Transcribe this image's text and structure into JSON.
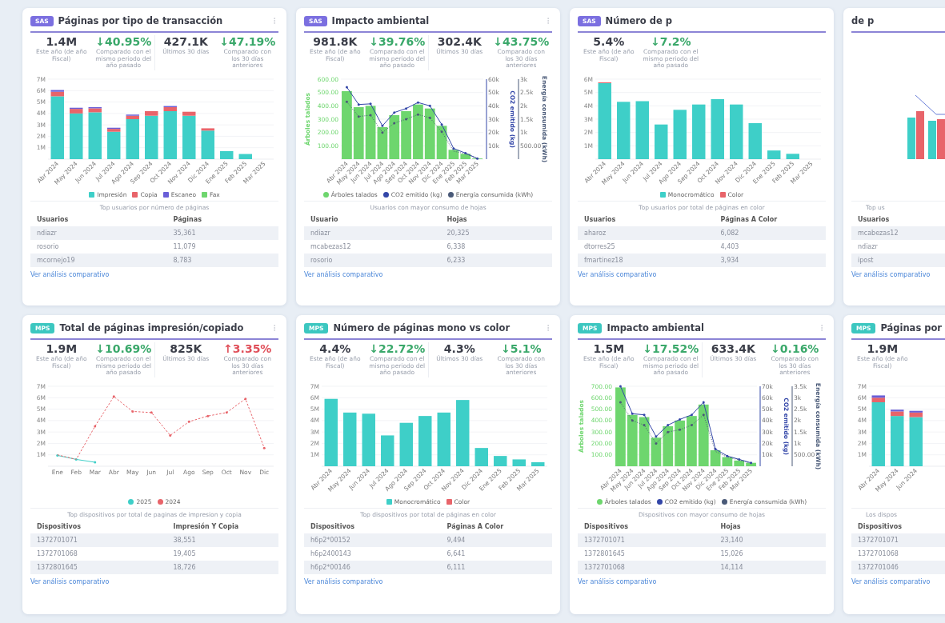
{
  "cards": [
    {
      "badge": {
        "text": "SAS",
        "color": "#7b6fe0"
      },
      "title": "Páginas por tipo de transacción",
      "menu_icon": true,
      "stats": [
        {
          "value": "1.4M",
          "label": "Este año (de año Fiscal)",
          "color": "#3a3d48"
        },
        {
          "value": "↓40.95%",
          "label": "Comparado con el mismo periodo del año pasado",
          "color": "#3aa86a"
        },
        {
          "value": "427.1K",
          "label": "Últimos 30 días",
          "color": "#3a3d48"
        },
        {
          "value": "↓47.19%",
          "label": "Comparado con los 30 días anteriores",
          "color": "#3aa86a"
        }
      ],
      "chart_data": {
        "type": "bar",
        "stacked": true,
        "grid": true,
        "categories": [
          "Abr 2024",
          "May 2024",
          "Jun 2024",
          "Jul 2024",
          "Ago 2024",
          "Sep 2024",
          "Oct 2024",
          "Nov 2024",
          "Dic 2024",
          "Ene 2025",
          "Feb 2025",
          "Mar 2025"
        ],
        "ylim": [
          0,
          7
        ],
        "yticks": [
          {
            "value": 1,
            "label": "1M"
          },
          {
            "value": 2,
            "label": "2M"
          },
          {
            "value": 3,
            "label": "3M"
          },
          {
            "value": 4,
            "label": "4M"
          },
          {
            "value": 5,
            "label": "5M"
          },
          {
            "value": 6,
            "label": "6M"
          },
          {
            "value": 7,
            "label": "7M"
          }
        ],
        "series": [
          {
            "name": "Impresión",
            "color": "#3ecfc8",
            "values": [
              5.5,
              4.0,
              4.1,
              2.4,
              3.5,
              3.8,
              4.2,
              3.8,
              2.5,
              0.7,
              0.45,
              0
            ]
          },
          {
            "name": "Copia",
            "color": "#e8646a",
            "values": [
              0.4,
              0.4,
              0.35,
              0.25,
              0.3,
              0.4,
              0.35,
              0.35,
              0.2,
              0.05,
              0.03,
              0
            ]
          },
          {
            "name": "Escaneo",
            "color": "#6a5fd8",
            "values": [
              0.15,
              0.1,
              0.1,
              0.1,
              0.1,
              0.05,
              0.1,
              0.05,
              0.05,
              0.02,
              0.01,
              0
            ]
          },
          {
            "name": "Fax",
            "color": "#6ed66e",
            "values": [
              0,
              0,
              0,
              0,
              0,
              0,
              0,
              0,
              0,
              0,
              0,
              0
            ]
          }
        ]
      },
      "table_title": "Top usuarios por número de páginas",
      "columns": [
        "Usuarios",
        "Páginas"
      ],
      "rows": [
        [
          "ndiazr",
          "35,361"
        ],
        [
          "rosorio",
          "11,079"
        ],
        [
          "mcornejo19",
          "8,783"
        ]
      ],
      "link": "Ver análisis comparativo"
    },
    {
      "badge": {
        "text": "SAS",
        "color": "#7b6fe0"
      },
      "title": "Impacto ambiental",
      "menu_icon": true,
      "stats": [
        {
          "value": "981.8K",
          "label": "Este año (de año Fiscal)",
          "color": "#3a3d48"
        },
        {
          "value": "↓39.76%",
          "label": "Comparado con el mismo periodo del año pasado",
          "color": "#3aa86a"
        },
        {
          "value": "302.4K",
          "label": "Últimos 30 días",
          "color": "#3a3d48"
        },
        {
          "value": "↓43.75%",
          "label": "Comparado con los 30 días anteriores",
          "color": "#3aa86a"
        }
      ],
      "chart_data": {
        "type": "bar",
        "grid": true,
        "ylabel": "Árboles talados",
        "categories": [
          "Abr 2024",
          "May 2024",
          "Jun 2024",
          "Jul 2024",
          "Ago 2024",
          "Sep 2024",
          "Oct 2024",
          "Nov 2024",
          "Dic 2024",
          "Ene 2025",
          "Feb 2025",
          "Mar 2025"
        ],
        "ylim": [
          0,
          600
        ],
        "yticks": [
          {
            "value": 100,
            "label": "100.00"
          },
          {
            "value": 200,
            "label": "200.00"
          },
          {
            "value": 300,
            "label": "300.00"
          },
          {
            "value": 400,
            "label": "400.00"
          },
          {
            "value": 500,
            "label": "500.00"
          },
          {
            "value": 600,
            "label": "600.00"
          }
        ],
        "series": [
          {
            "name": "Árboles talados",
            "color": "#6ed66e",
            "values": [
              510,
              390,
              400,
              240,
              330,
              360,
              410,
              380,
              250,
              70,
              40,
              5
            ]
          },
          {
            "name": "CO2 emitido (kg)",
            "color": "#3346a8",
            "type": "line",
            "line_style": "solid",
            "values": [
              540,
              410,
              415,
              250,
              350,
              380,
              425,
              400,
              260,
              80,
              45,
              5
            ]
          },
          {
            "name": "Energía consumida (kWh)",
            "color": "#4a5a78",
            "type": "line",
            "line_style": "dotted",
            "values": [
              430,
              320,
              330,
              200,
              270,
              300,
              335,
              310,
              205,
              60,
              40,
              5
            ]
          }
        ]
      },
      "right_axes": [
        {
          "title": "CO2 emitido (kg)",
          "color": "#3346a8",
          "ticks": [
            "60k",
            "50k",
            "40k",
            "30k",
            "20k",
            "10k"
          ]
        },
        {
          "title": "Energía consumida (kWh)",
          "color": "#4a5a78",
          "ticks": [
            "3k",
            "2.5k",
            "2k",
            "1.5k",
            "1k",
            "500.00"
          ]
        }
      ],
      "table_title": "Usuarios con mayor consumo de hojas",
      "columns": [
        "Usuario",
        "Hojas"
      ],
      "rows": [
        [
          "ndiazr",
          "20,325"
        ],
        [
          "mcabezas12",
          "6,338"
        ],
        [
          "rosorio",
          "6,233"
        ]
      ],
      "link": "Ver análisis comparativo"
    },
    {
      "badge": {
        "text": "SAS",
        "color": "#7b6fe0"
      },
      "title": "Número de p",
      "menu_icon": false,
      "stats": [
        {
          "value": "5.4%",
          "label": "Este año (de año Fiscal)",
          "color": "#3a3d48"
        },
        {
          "value": "↓7.2%",
          "label": "Comparado con el mismo periodo del año pasado",
          "color": "#3aa86a"
        }
      ],
      "chart_data": {
        "type": "bar",
        "stacked": true,
        "grid": true,
        "categories": [
          "Abr 2024",
          "May 2024",
          "Jun 2024",
          "Jul 2024",
          "Ago 2024",
          "Sep 2024",
          "Oct 2024",
          "Nov 2024",
          "Dic 2024",
          "Ene 2025",
          "Feb 2025",
          "Mar 2025"
        ],
        "ylim": [
          0,
          6
        ],
        "yticks": [
          {
            "value": 1,
            "label": "1M"
          },
          {
            "value": 2,
            "label": "2M"
          },
          {
            "value": 3,
            "label": "3M"
          },
          {
            "value": 4,
            "label": "4M"
          },
          {
            "value": 5,
            "label": "5M"
          },
          {
            "value": 6,
            "label": "6M"
          }
        ],
        "series": [
          {
            "name": "Monocromático",
            "color": "#3ecfc8",
            "values": [
              5.7,
              4.3,
              4.35,
              2.6,
              3.7,
              4.1,
              4.5,
              4.1,
              2.7,
              0.65,
              0.4,
              0
            ]
          },
          {
            "name": "Color",
            "color": "#e8646a",
            "values": [
              0.06,
              0.02,
              0.02,
              0,
              0,
              0,
              0,
              0,
              0,
              0,
              0,
              0
            ]
          }
        ]
      },
      "table_title": "Top usuarios por total de páginas en color",
      "columns": [
        "Usuarios",
        "Páginas A Color"
      ],
      "rows": [
        [
          "aharoz",
          "6,082"
        ],
        [
          "dtorres25",
          "4,403"
        ],
        [
          "fmartinez18",
          "3,934"
        ]
      ],
      "link": "Ver análisis comparativo"
    },
    {
      "title": "de p",
      "menu_icon": false,
      "table_title": "Top us",
      "columns": [
        "Usuarios"
      ],
      "rows": [
        [
          "mcabezas12"
        ],
        [
          "ndiazr"
        ],
        [
          "ipost"
        ]
      ],
      "link": "Ver análisis comparativo"
    },
    {
      "badge": {
        "text": "MPS",
        "color": "#3cc7c0"
      },
      "title": "Total de páginas impresión/copiado",
      "menu_icon": true,
      "stats": [
        {
          "value": "1.9M",
          "label": "Este año (de año Fiscal)",
          "color": "#3a3d48"
        },
        {
          "value": "↓10.69%",
          "label": "Comparado con el mismo periodo del año pasado",
          "color": "#3aa86a"
        },
        {
          "value": "825K",
          "label": "Últimos 30 días",
          "color": "#3a3d48"
        },
        {
          "value": "↑3.35%",
          "label": "Comparado con los 30 días anteriores",
          "color": "#e0505a"
        }
      ],
      "chart_data": {
        "type": "line",
        "grid": true,
        "categories": [
          "Ene",
          "Feb",
          "Mar",
          "Abr",
          "May",
          "Jun",
          "Jul",
          "Ago",
          "Sep",
          "Oct",
          "Nov",
          "Dic"
        ],
        "ylim": [
          0,
          7
        ],
        "yticks": [
          {
            "value": 1,
            "label": "1M"
          },
          {
            "value": 2,
            "label": "2M"
          },
          {
            "value": 3,
            "label": "3M"
          },
          {
            "value": 4,
            "label": "4M"
          },
          {
            "value": 5,
            "label": "5M"
          },
          {
            "value": 6,
            "label": "6M"
          },
          {
            "value": 7,
            "label": "7M"
          }
        ],
        "series": [
          {
            "name": "2025",
            "color": "#3ecfc8",
            "line_style": "solid",
            "values": [
              0.95,
              0.6,
              0.35,
              null,
              null,
              null,
              null,
              null,
              null,
              null,
              null,
              null
            ]
          },
          {
            "name": "2024",
            "color": "#e8646a",
            "line_style": "dashed",
            "values": [
              1.0,
              0.6,
              3.5,
              6.1,
              4.8,
              4.7,
              2.7,
              3.9,
              4.4,
              4.7,
              5.9,
              1.6
            ]
          }
        ]
      },
      "table_title": "Top dispositivos por total de paginas de impresion y copia",
      "columns": [
        "Dispositivos",
        "Impresión Y Copia"
      ],
      "rows": [
        [
          "1372701071",
          "38,551"
        ],
        [
          "1372701068",
          "19,405"
        ],
        [
          "1372801645",
          "18,726"
        ]
      ],
      "link": "Ver análisis comparativo"
    },
    {
      "badge": {
        "text": "MPS",
        "color": "#3cc7c0"
      },
      "title": "Número de páginas mono vs color",
      "menu_icon": true,
      "stats": [
        {
          "value": "4.4%",
          "label": "Este año (de año Fiscal)",
          "color": "#3a3d48"
        },
        {
          "value": "↓22.72%",
          "label": "Comparado con el mismo periodo del año pasado",
          "color": "#3aa86a"
        },
        {
          "value": "4.3%",
          "label": "Últimos 30 días",
          "color": "#3a3d48"
        },
        {
          "value": "↓5.1%",
          "label": "Comparado con los 30 días anteriores",
          "color": "#3aa86a"
        }
      ],
      "chart_data": {
        "type": "bar",
        "stacked": true,
        "grid": true,
        "categories": [
          "Abr 2024",
          "May 2024",
          "Jun 2024",
          "Jul 2024",
          "Ago 2024",
          "Sep 2024",
          "Oct 2024",
          "Nov 2024",
          "Dic 2024",
          "Ene 2025",
          "Feb 2025",
          "Mar 2025"
        ],
        "ylim": [
          0,
          7
        ],
        "yticks": [
          {
            "value": 1,
            "label": "1M"
          },
          {
            "value": 2,
            "label": "2M"
          },
          {
            "value": 3,
            "label": "3M"
          },
          {
            "value": 4,
            "label": "4M"
          },
          {
            "value": 5,
            "label": "5M"
          },
          {
            "value": 6,
            "label": "6M"
          },
          {
            "value": 7,
            "label": "7M"
          }
        ],
        "series": [
          {
            "name": "Monocromático",
            "color": "#3ecfc8",
            "values": [
              5.9,
              4.7,
              4.6,
              2.7,
              3.8,
              4.4,
              4.7,
              5.8,
              1.6,
              0.9,
              0.6,
              0.35
            ]
          },
          {
            "name": "Color",
            "color": "#e8646a",
            "values": [
              0.05,
              0.05,
              0,
              0,
              0,
              0,
              0,
              0.05,
              0,
              0,
              0,
              0
            ]
          }
        ]
      },
      "table_title": "Top dispositivos por total de páginas en color",
      "columns": [
        "Dispositivos",
        "Páginas A Color"
      ],
      "rows": [
        [
          "h6p2*00152",
          "9,494"
        ],
        [
          "h6p2400143",
          "6,641"
        ],
        [
          "h6p2*00146",
          "6,111"
        ]
      ],
      "link": "Ver análisis comparativo"
    },
    {
      "badge": {
        "text": "MPS",
        "color": "#3cc7c0"
      },
      "title": "Impacto ambiental",
      "menu_icon": true,
      "stats": [
        {
          "value": "1.5M",
          "label": "Este año (de año Fiscal)",
          "color": "#3a3d48"
        },
        {
          "value": "↓17.52%",
          "label": "Comparado con el mismo periodo del año pasado",
          "color": "#3aa86a"
        },
        {
          "value": "633.4K",
          "label": "Últimos 30 días",
          "color": "#3a3d48"
        },
        {
          "value": "↓0.16%",
          "label": "Comparado con los 30 días anteriores",
          "color": "#3aa86a"
        }
      ],
      "chart_data": {
        "type": "bar",
        "grid": true,
        "ylabel": "Árboles talados",
        "categories": [
          "Abr 2024",
          "May 2024",
          "Jun 2024",
          "Jul 2024",
          "Ago 2024",
          "Sep 2024",
          "Oct 2024",
          "Nov 2024",
          "Dic 2024",
          "Ene 2025",
          "Feb 2025",
          "Mar 2025"
        ],
        "ylim": [
          0,
          700
        ],
        "yticks": [
          {
            "value": 100,
            "label": "100.00"
          },
          {
            "value": 200,
            "label": "200.00"
          },
          {
            "value": 300,
            "label": "300.00"
          },
          {
            "value": 400,
            "label": "400.00"
          },
          {
            "value": 500,
            "label": "500.00"
          },
          {
            "value": 600,
            "label": "600.00"
          },
          {
            "value": 700,
            "label": "700.00"
          }
        ],
        "series": [
          {
            "name": "Árboles talados",
            "color": "#6ed66e",
            "values": [
              690,
              450,
              430,
              250,
              350,
              400,
              440,
              540,
              140,
              80,
              50,
              30
            ]
          },
          {
            "name": "CO2 emitido (kg)",
            "color": "#3346a8",
            "type": "line",
            "line_style": "solid",
            "values": [
              700,
              460,
              450,
              260,
              360,
              410,
              450,
              560,
              150,
              90,
              60,
              30
            ]
          },
          {
            "name": "Energía consumida (kWh)",
            "color": "#4a5a78",
            "type": "line",
            "line_style": "dotted",
            "values": [
              560,
              400,
              360,
              200,
              300,
              320,
              360,
              450,
              130,
              80,
              55,
              25
            ]
          }
        ]
      },
      "right_axes": [
        {
          "title": "CO2 emitido (kg)",
          "color": "#3346a8",
          "ticks": [
            "70k",
            "60k",
            "50k",
            "40k",
            "30k",
            "20k",
            "10k"
          ]
        },
        {
          "title": "Energía consumida (kWh)",
          "color": "#4a5a78",
          "ticks": [
            "3.5k",
            "3k",
            "2.5k",
            "2k",
            "1.5k",
            "1k",
            "500.00"
          ]
        }
      ],
      "table_title": "Dispositivos con mayor consumo de hojas",
      "columns": [
        "Dispositivos",
        "Hojas"
      ],
      "rows": [
        [
          "1372701071",
          "23,140"
        ],
        [
          "1372801645",
          "15,026"
        ],
        [
          "1372701068",
          "14,114"
        ]
      ],
      "link": "Ver análisis comparativo"
    },
    {
      "badge": {
        "text": "MPS",
        "color": "#3cc7c0"
      },
      "title": "Páginas por",
      "menu_icon": false,
      "stats": [
        {
          "value": "1.9M",
          "label": "Este año (de año Fiscal)",
          "color": "#3a3d48"
        }
      ],
      "chart_data": {
        "type": "bar",
        "stacked": true,
        "grid": true,
        "categories": [
          "Abr 2024",
          "May 2024",
          "Jun 2024"
        ],
        "ylim": [
          0,
          7
        ],
        "yticks": [
          {
            "value": 1,
            "label": "1M"
          },
          {
            "value": 2,
            "label": "2M"
          },
          {
            "value": 3,
            "label": "3M"
          },
          {
            "value": 4,
            "label": "4M"
          },
          {
            "value": 5,
            "label": "5M"
          },
          {
            "value": 6,
            "label": "6M"
          },
          {
            "value": 7,
            "label": "7M"
          }
        ],
        "series": [
          {
            "color": "#3ecfc8",
            "values": [
              5.6,
              4.4,
              4.3
            ]
          },
          {
            "color": "#e8646a",
            "values": [
              0.4,
              0.4,
              0.4
            ]
          },
          {
            "color": "#6a5fd8",
            "values": [
              0.2,
              0.15,
              0.15
            ]
          }
        ]
      },
      "table_title": "Los dispos",
      "columns": [
        "Dispositivos"
      ],
      "rows": [
        [
          "1372701071"
        ],
        [
          "1372701068"
        ],
        [
          "1372701046"
        ]
      ],
      "link": "Ver análisis comparativo"
    }
  ]
}
